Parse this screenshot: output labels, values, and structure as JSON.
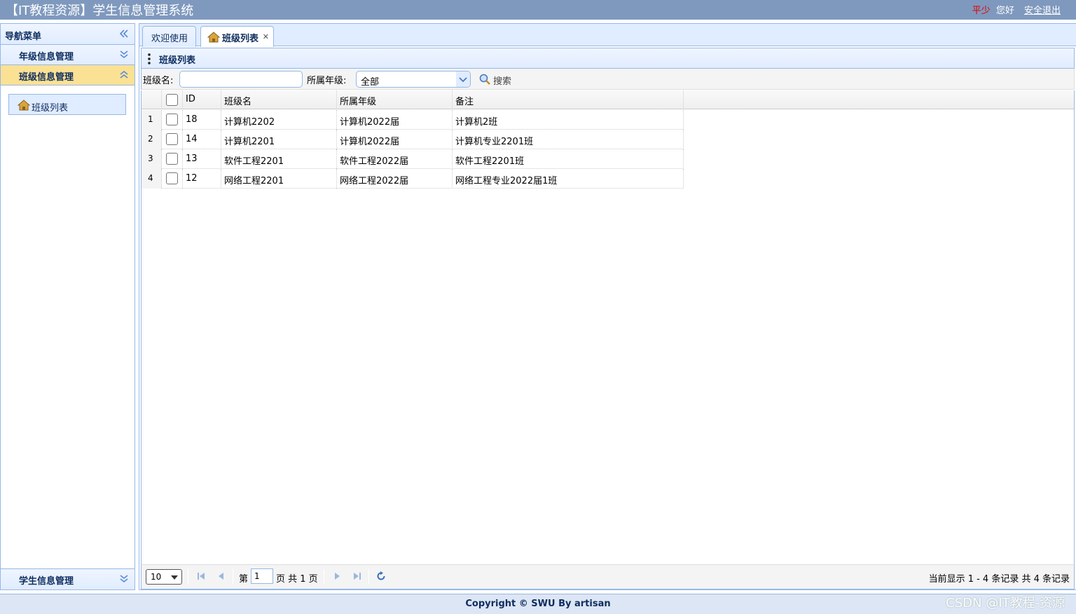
{
  "header": {
    "app_title": "【IT教程资源】学生信息管理系统",
    "user_name": "平少",
    "greeting": "您好",
    "logout_label": "安全退出"
  },
  "nav": {
    "title": "导航菜单",
    "sections": [
      {
        "label": "年级信息管理"
      },
      {
        "label": "班级信息管理"
      }
    ],
    "class_link": "班级列表",
    "bottom_section": "学生信息管理"
  },
  "tabs": [
    {
      "label": "欢迎使用"
    },
    {
      "label": "班级列表"
    }
  ],
  "panel_title": "班级列表",
  "toolbar": {
    "class_name_label": "班级名:",
    "class_name_value": "",
    "grade_label": "所属年级:",
    "grade_value": "全部",
    "search_label": "搜索"
  },
  "grid": {
    "columns": [
      "ID",
      "班级名",
      "所属年级",
      "备注"
    ],
    "rows": [
      {
        "n": "1",
        "id": "18",
        "name": "计算机2202",
        "grade": "计算机2022届",
        "remark": "计算机2班"
      },
      {
        "n": "2",
        "id": "14",
        "name": "计算机2201",
        "grade": "计算机2022届",
        "remark": "计算机专业2201班"
      },
      {
        "n": "3",
        "id": "13",
        "name": "软件工程2201",
        "grade": "软件工程2022届",
        "remark": "软件工程2201班"
      },
      {
        "n": "4",
        "id": "12",
        "name": "网络工程2201",
        "grade": "网络工程2022届",
        "remark": "网络工程专业2022届1班"
      }
    ]
  },
  "pager": {
    "page_size": "10",
    "page_prefix": "第",
    "page_value": "1",
    "page_suffix": "页 共 1 页",
    "info": "当前显示 1 - 4 条记录 共 4 条记录"
  },
  "footer": {
    "copyright": "Copyright © SWU By artisan"
  },
  "watermark": "CSDN @IT教程-资源",
  "colors": {
    "header_bg": "#7f99be",
    "border": "#95b8e7",
    "panel_header": "#e0ecff",
    "selected_section": "#fbe193",
    "username": "#e00000"
  }
}
